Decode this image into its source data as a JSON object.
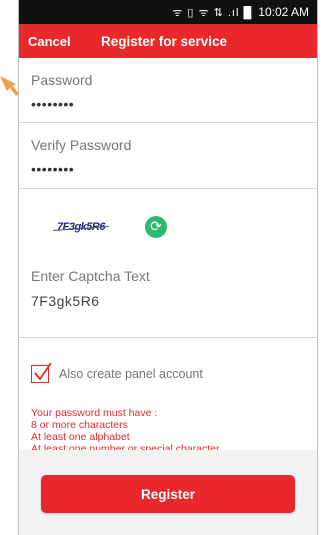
{
  "status_bar": {
    "icons": "ᯤ ▯ ᯤ ⇅ .ıl █",
    "time": "10:02 AM"
  },
  "header": {
    "cancel": "Cancel",
    "title": "Register for service"
  },
  "form": {
    "password_label": "Password",
    "password_value": "••••••••",
    "verify_password_label": "Verify Password",
    "verify_password_value": "••••••••",
    "captcha_image_text": "7F3gk5R6",
    "captcha_field_label": "Enter Captcha Text",
    "captcha_field_value": "7F3gk5R6",
    "checkbox_label": "Also create panel account"
  },
  "password_rules": [
    "Your password must have :",
    "8 or more characters",
    "At least one alphabet",
    "At least one number or special character"
  ],
  "register_button": "Register",
  "colors": {
    "accent": "#e8282b",
    "refresh": "#2eb872",
    "arrow": "#f0a04b"
  }
}
